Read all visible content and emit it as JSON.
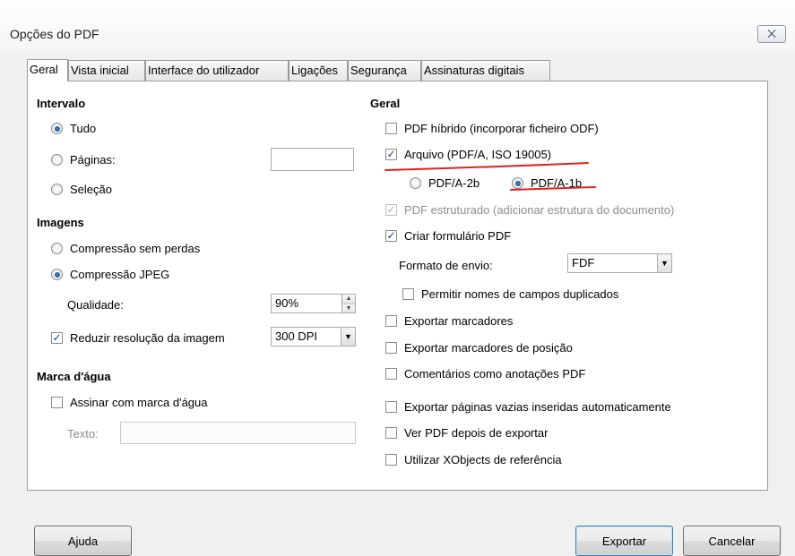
{
  "window": {
    "title": "Opções do PDF",
    "close_glyph": "⨉"
  },
  "tabs": [
    "Geral",
    "Vista inicial",
    "Interface do utilizador",
    "Ligações",
    "Segurança",
    "Assinaturas digitais"
  ],
  "range": {
    "title": "Intervalo",
    "all": "Tudo",
    "pages": "Páginas:",
    "pages_value": "",
    "selection": "Seleção",
    "selected": "all"
  },
  "images": {
    "title": "Imagens",
    "lossless": "Compressão sem perdas",
    "jpeg": "Compressão JPEG",
    "selected": "jpeg",
    "quality_label": "Qualidade:",
    "quality_value": "90%",
    "reduce_label": "Reduzir resolução da imagem",
    "reduce_checked": true,
    "resolution_value": "300 DPI"
  },
  "watermark": {
    "title": "Marca d'água",
    "sign_label": "Assinar com marca d'água",
    "sign_checked": false,
    "text_label": "Texto:",
    "text_value": ""
  },
  "general": {
    "title": "Geral",
    "hybrid": "PDF híbrido (incorporar ficheiro ODF)",
    "archive": "Arquivo (PDF/A, ISO 19005)",
    "pdfa2b": "PDF/A-2b",
    "pdfa1b": "PDF/A-1b",
    "pdfa_selected": "1b",
    "tagged": "PDF estruturado (adicionar estrutura do documento)",
    "create_form": "Criar formulário PDF",
    "submit_format_label": "Formato de envio:",
    "submit_format_value": "FDF",
    "allow_duplicates": "Permitir nomes de campos duplicados",
    "export_bookmarks": "Exportar marcadores",
    "export_placeholders": "Exportar marcadores de posição",
    "comments": "Comentários como anotações PDF",
    "export_empty_pages": "Exportar páginas vazias inseridas automaticamente",
    "view_after": "Ver PDF depois de exportar",
    "xobjects": "Utilizar XObjects de referência"
  },
  "buttons": {
    "help": "Ajuda",
    "export": "Exportar",
    "cancel": "Cancelar"
  },
  "colors": {
    "annotation_red": "#e02020",
    "accent": "#1b4a88"
  }
}
